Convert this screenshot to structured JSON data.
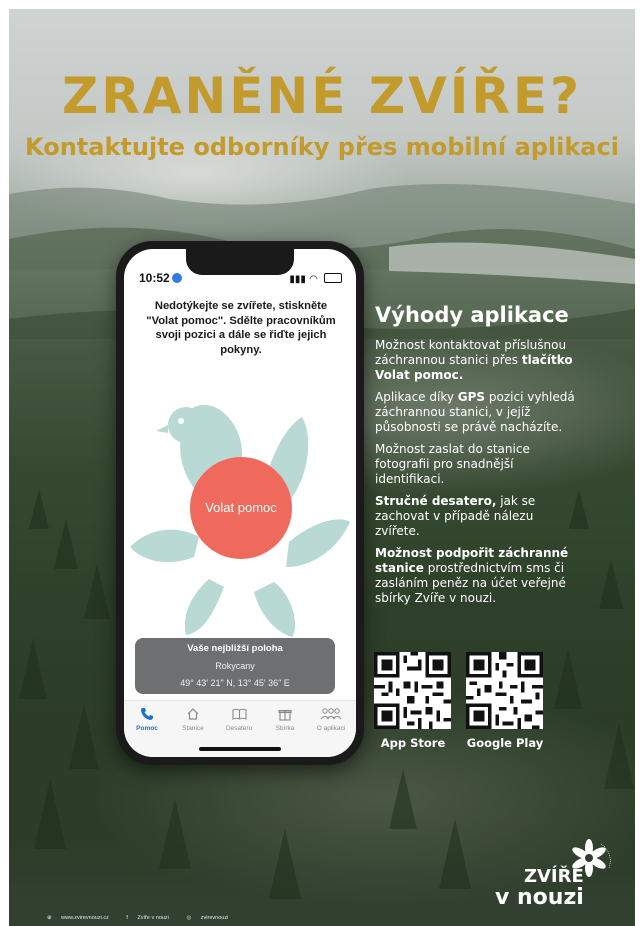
{
  "headline": {
    "title": "ZRANĚNÉ ZVÍŘE?",
    "subtitle": "Kontaktujte odborníky přes mobilní aplikaci"
  },
  "phone": {
    "status_time": "10:52",
    "instruction": "Nedotýkejte se zvířete, stiskněte \"Volat pomoc\". Sdělte pracovníkům svoji pozici a dále se řiďte jejich pokyny.",
    "call_button_label": "Volat pomoc",
    "location_card": {
      "heading": "Vaše nejbližší poloha",
      "city": "Rokycany",
      "coordinates": "49° 43' 21\" N, 13° 45' 36\" E"
    },
    "tabs": [
      {
        "label": "Pomoc",
        "icon": "phone-icon",
        "active": true
      },
      {
        "label": "Stanice",
        "icon": "home-icon",
        "active": false
      },
      {
        "label": "Desatero",
        "icon": "book-icon",
        "active": false
      },
      {
        "label": "Sbírka",
        "icon": "gift-icon",
        "active": false
      },
      {
        "label": "O aplikaci",
        "icon": "people-icon",
        "active": false
      }
    ],
    "colors": {
      "call_button": "#ef6a5c",
      "petals": "#b8d9d4",
      "active_tab": "#1f6fd0"
    }
  },
  "benefits": {
    "heading": "Výhody aplikace",
    "items": [
      {
        "before": "Možnost kontaktovat příslušnou záchrannou stanici přes ",
        "bold": "tlačítko Volat pomoc.",
        "after": ""
      },
      {
        "before": "Aplikace díky ",
        "bold": "GPS",
        "after": " pozici vyhledá záchrannou stanici, v jejíž působnosti se právě nacházíte."
      },
      {
        "before": "Možnost zaslat do stanice fotografii pro snadnější identifikaci.",
        "bold": "",
        "after": ""
      },
      {
        "before": "",
        "bold": "Stručné desatero,",
        "after": " jak se zachovat v případě nálezu zvířete."
      },
      {
        "before": "",
        "bold": "Možnost podpořit záchranné stanice",
        "after": " prostřednictvím sms či zasláním peněz na účet veřejné sbírky Zvíře v nouzi."
      }
    ]
  },
  "stores": {
    "app_store_label": "App Store",
    "google_play_label": "Google Play"
  },
  "logo": {
    "line1": "ZVÍŘE",
    "line2": "v nouzi",
    "tagline": "Zvíře v nouzi"
  },
  "footer": {
    "website": "www.zvirevnouzi.cz",
    "facebook": "Zvíře v nouzi",
    "instagram": "zvirevnouzi"
  },
  "colors": {
    "title": "#c39a2c"
  }
}
